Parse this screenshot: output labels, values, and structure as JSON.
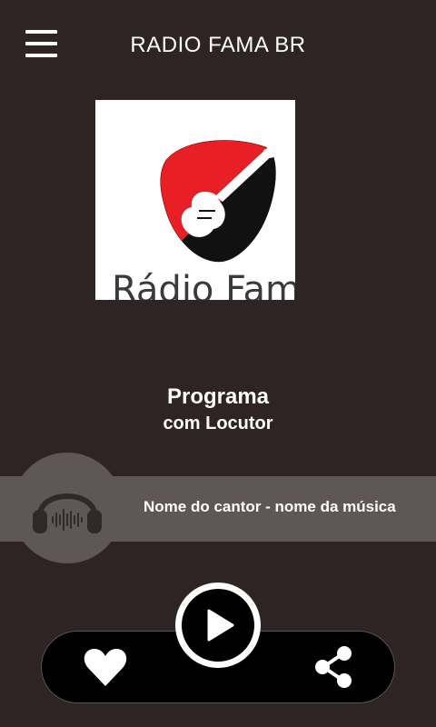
{
  "header": {
    "title": "RADIO FAMA BR",
    "menu_icon": "hamburger-menu-icon"
  },
  "logo": {
    "text": "Rádio Fama",
    "colors": {
      "pick_red": "#e81f25",
      "pick_black": "#111111",
      "text": "#3a3a3a"
    }
  },
  "program": {
    "title": "Programa",
    "host": "com Locutor"
  },
  "now_playing": {
    "text": "Nome do cantor - nome da música",
    "icon": "headphones-icon"
  },
  "controls": {
    "play_icon": "play-icon",
    "favorite_icon": "heart-icon",
    "share_icon": "share-icon"
  },
  "colors": {
    "background": "#2d2423",
    "now_bar": "#5e5756",
    "controls_bar": "#000000",
    "accent_white": "#ffffff"
  }
}
